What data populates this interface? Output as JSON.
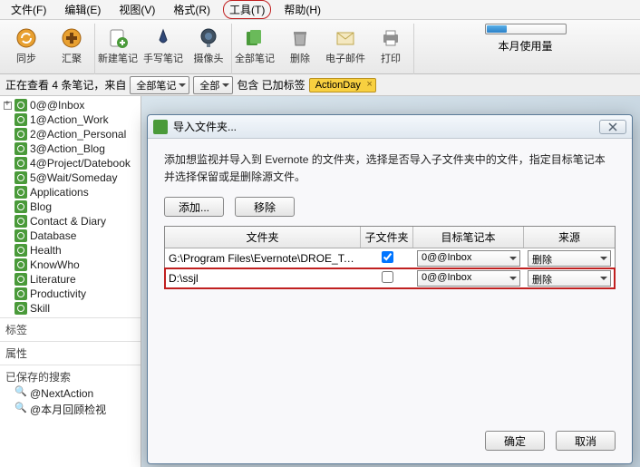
{
  "menu": {
    "file": "文件(F)",
    "edit": "编辑(E)",
    "view": "视图(V)",
    "format": "格式(R)",
    "tools": "工具(T)",
    "help": "帮助(H)"
  },
  "toolbar": {
    "sync": "同步",
    "hub": "汇聚",
    "new_note": "新建笔记",
    "handwrite": "手写笔记",
    "camera": "摄像头",
    "all_notes": "全部笔记",
    "delete": "删除",
    "email": "电子邮件",
    "print": "打印",
    "usage_label": "本月使用量"
  },
  "filter": {
    "status": "正在查看 4 条笔记，来自",
    "scope": "全部笔记",
    "all": "全部",
    "contains": "包含 已加标签",
    "tag": "ActionDay"
  },
  "sidebar": {
    "notebooks": [
      "0@@Inbox",
      "1@Action_Work",
      "2@Action_Personal",
      "3@Action_Blog",
      "4@Project/Datebook",
      "5@Wait/Someday",
      "Applications",
      "Blog",
      "Contact & Diary",
      "Database",
      "Health",
      "KnowWho",
      "Literature",
      "Productivity",
      "Skill"
    ],
    "section_tags": "标签",
    "section_attrs": "属性",
    "section_saved": "已保存的搜索",
    "saved_searches": [
      "@NextAction",
      "@本月回顾检视"
    ]
  },
  "dialog": {
    "title": "导入文件夹...",
    "desc": "添加想监视并导入到 Evernote 的文件夹，选择是否导入子文件夹中的文件，指定目标笔记本并选择保留或是删除源文件。",
    "add_btn": "添加...",
    "remove_btn": "移除",
    "cols": {
      "folder": "文件夹",
      "sub": "子文件夹",
      "notebook": "目标笔记本",
      "source": "来源"
    },
    "rows": [
      {
        "folder": "G:\\Program Files\\Evernote\\DROE_Tool\\DR...",
        "sub": true,
        "notebook": "0@@Inbox",
        "source": "删除",
        "hl": false
      },
      {
        "folder": "D:\\ssjl",
        "sub": false,
        "notebook": "0@@Inbox",
        "source": "删除",
        "hl": true
      }
    ],
    "ok": "确定",
    "cancel": "取消"
  }
}
